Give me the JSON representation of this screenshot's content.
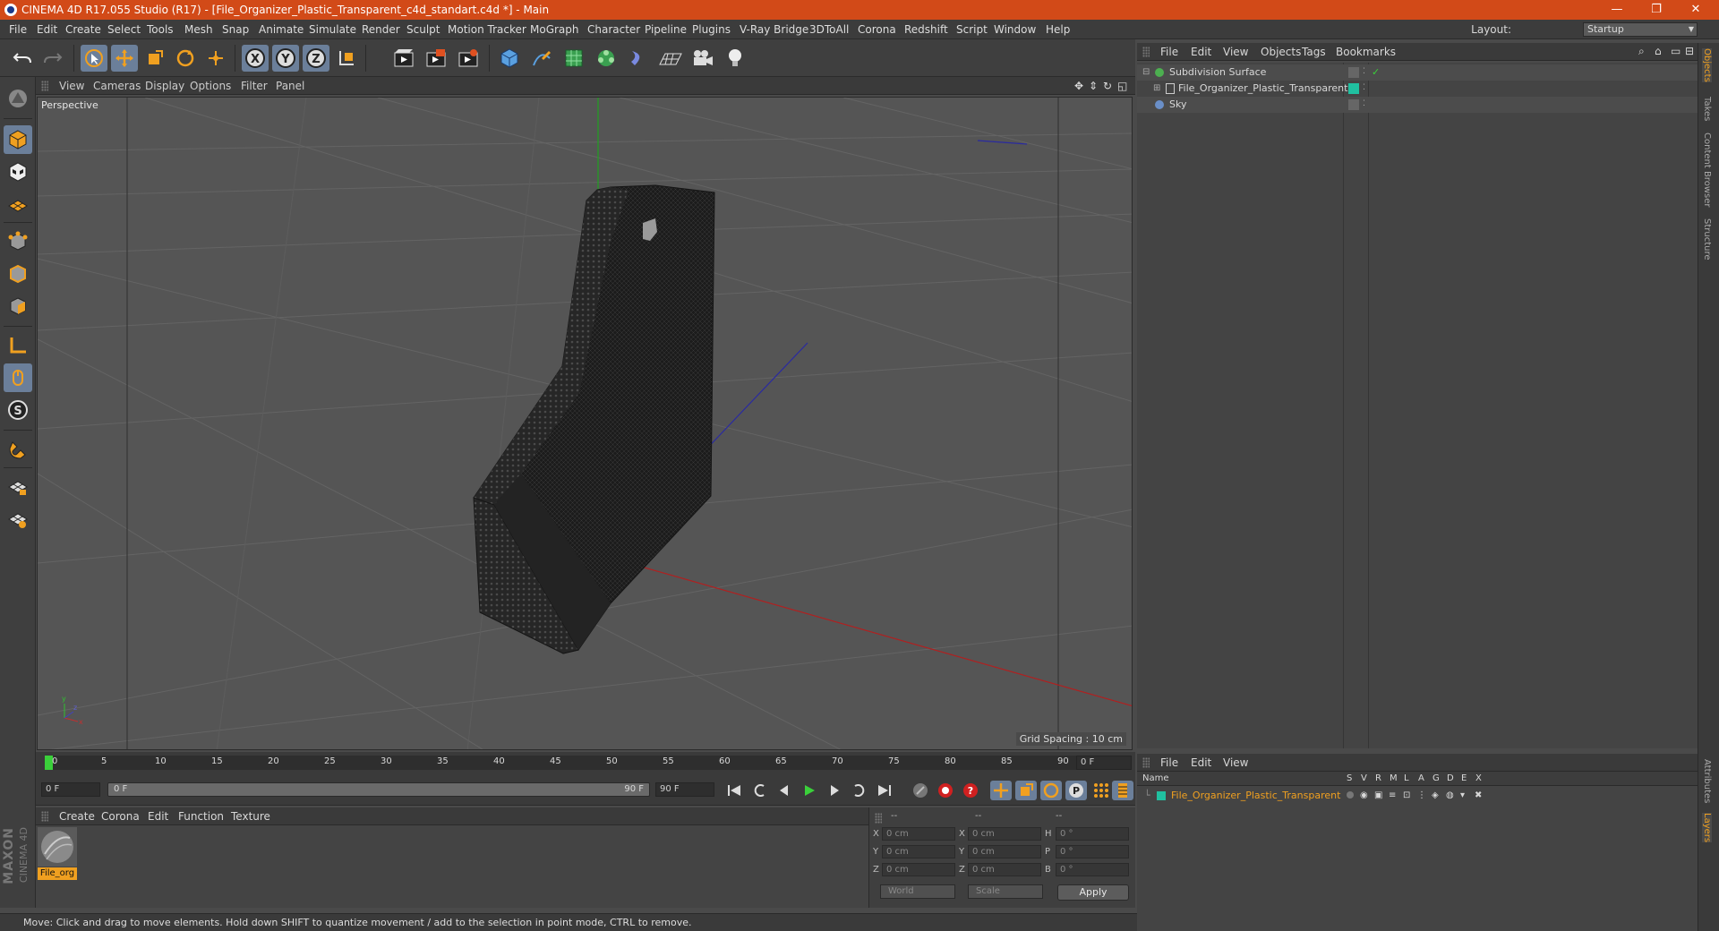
{
  "window": {
    "title": "CINEMA 4D R17.055 Studio (R17) - [File_Organizer_Plastic_Transparent_c4d_standart.c4d *] - Main",
    "controls": [
      "minimize-icon",
      "restore-icon",
      "close-icon"
    ]
  },
  "menubar": {
    "items": [
      "File",
      "Edit",
      "Create",
      "Select",
      "Tools",
      "Mesh",
      "Snap",
      "Animate",
      "Simulate",
      "Render",
      "Sculpt",
      "Motion Tracker",
      "MoGraph",
      "Character",
      "Pipeline",
      "Plugins",
      "V-Ray Bridge",
      "3DToAll",
      "Corona",
      "Redshift",
      "Script",
      "Window",
      "Help"
    ],
    "layout_label": "Layout:",
    "layout_value": "Startup"
  },
  "viewport": {
    "menu": [
      "View",
      "Cameras",
      "Display",
      "Options",
      "Filter",
      "Panel"
    ],
    "label": "Perspective",
    "grid_spacing": "Grid Spacing : 10 cm"
  },
  "timeline": {
    "ticks": [
      "0",
      "5",
      "10",
      "15",
      "20",
      "25",
      "30",
      "35",
      "40",
      "45",
      "50",
      "55",
      "60",
      "65",
      "70",
      "75",
      "80",
      "85",
      "90"
    ],
    "current_frame_right": "0 F",
    "start_field": "0 F",
    "range_start": "0 F",
    "range_end": "90 F",
    "end_field": "90 F"
  },
  "material_manager": {
    "menu": [
      "Create",
      "Corona",
      "Edit",
      "Function",
      "Texture"
    ],
    "materials": [
      {
        "name": "File_org"
      }
    ]
  },
  "coordinates": {
    "headers": [
      "--",
      "--",
      "--"
    ],
    "rows": [
      {
        "axis": "X",
        "pos": "0 cm",
        "axis2": "X",
        "size": "0 cm",
        "rot_axis": "H",
        "rot": "0 °"
      },
      {
        "axis": "Y",
        "pos": "0 cm",
        "axis2": "Y",
        "size": "0 cm",
        "rot_axis": "P",
        "rot": "0 °"
      },
      {
        "axis": "Z",
        "pos": "0 cm",
        "axis2": "Z",
        "size": "0 cm",
        "rot_axis": "B",
        "rot": "0 °"
      }
    ],
    "mode_select": "World",
    "scale_select": "Scale",
    "apply_label": "Apply"
  },
  "status": {
    "text": "Move: Click and drag to move elements. Hold down SHIFT to quantize movement / add to the selection in point mode, CTRL to remove."
  },
  "object_manager": {
    "menu": [
      "File",
      "Edit",
      "View",
      "Objects",
      "Tags",
      "Bookmarks"
    ],
    "objects": [
      {
        "name": "Subdivision Surface",
        "color": "#4caf50"
      },
      {
        "name": "File_Organizer_Plastic_Transparent",
        "color": "#20c0a0"
      },
      {
        "name": "Sky",
        "color": "#6a8fc8"
      }
    ]
  },
  "layer_manager": {
    "menu": [
      "File",
      "Edit",
      "View"
    ],
    "columns": [
      "Name",
      "S",
      "V",
      "R",
      "M",
      "L",
      "A",
      "G",
      "D",
      "E",
      "X"
    ],
    "layers": [
      {
        "name": "File_Organizer_Plastic_Transparent",
        "color": "#20c0a0"
      }
    ]
  },
  "side_tabs": [
    "Objects",
    "Takes",
    "Content Browser",
    "Structure",
    "Attributes",
    "Layers"
  ],
  "brand": {
    "maxon": "MAXON",
    "product": "CINEMA 4D"
  },
  "colors": {
    "accent": "#d24a18",
    "selected": "#6b7f9a",
    "highlight_text": "#f0a020"
  }
}
